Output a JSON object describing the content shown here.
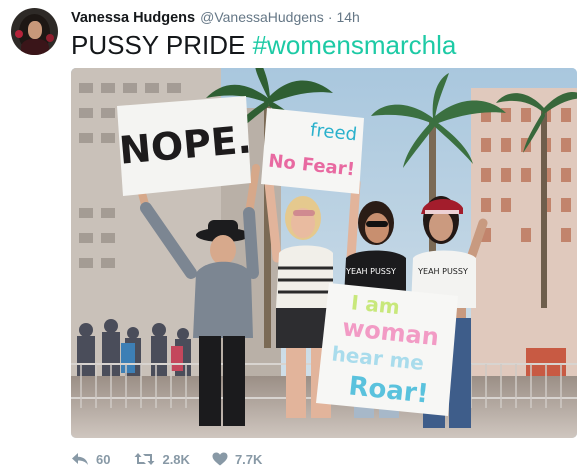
{
  "user": {
    "display_name": "Vanessa Hudgens",
    "handle": "@VanessaHudgens",
    "separator": "·",
    "timestamp": "14h"
  },
  "tweet": {
    "text": "PUSSY PRIDE",
    "hashtag": "#womensmarchla"
  },
  "photo_signs": {
    "nope": "NOPE.",
    "fear_top": "freed",
    "fear": "No Fear!",
    "shirt1": "YEAH PUSSY",
    "shirt2": "YEAH PUSSY",
    "roar_line1": "I am",
    "roar_line2": "woman",
    "roar_line3": "hear me",
    "roar_line4": "Roar!"
  },
  "actions": {
    "reply_count": "60",
    "retweet_count": "2.8K",
    "like_count": "7.7K"
  },
  "colors": {
    "hashtag": "#1dcaa5",
    "action_gray": "#8899a6",
    "handle_gray": "#657786"
  },
  "icons": [
    "reply-icon",
    "retweet-icon",
    "heart-icon"
  ]
}
